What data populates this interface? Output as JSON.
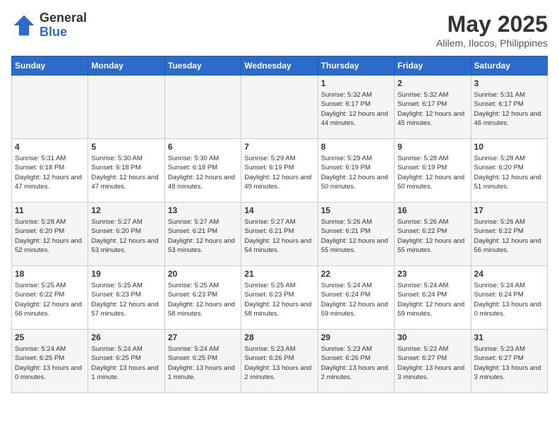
{
  "logo": {
    "general": "General",
    "blue": "Blue"
  },
  "title": "May 2025",
  "location": "Alilem, Ilocos, Philippines",
  "days_of_week": [
    "Sunday",
    "Monday",
    "Tuesday",
    "Wednesday",
    "Thursday",
    "Friday",
    "Saturday"
  ],
  "weeks": [
    [
      {
        "day": "",
        "info": ""
      },
      {
        "day": "",
        "info": ""
      },
      {
        "day": "",
        "info": ""
      },
      {
        "day": "",
        "info": ""
      },
      {
        "day": "1",
        "info": "Sunrise: 5:32 AM\nSunset: 6:17 PM\nDaylight: 12 hours\nand 44 minutes."
      },
      {
        "day": "2",
        "info": "Sunrise: 5:32 AM\nSunset: 6:17 PM\nDaylight: 12 hours\nand 45 minutes."
      },
      {
        "day": "3",
        "info": "Sunrise: 5:31 AM\nSunset: 6:17 PM\nDaylight: 12 hours\nand 46 minutes."
      }
    ],
    [
      {
        "day": "4",
        "info": "Sunrise: 5:31 AM\nSunset: 6:18 PM\nDaylight: 12 hours\nand 47 minutes."
      },
      {
        "day": "5",
        "info": "Sunrise: 5:30 AM\nSunset: 6:18 PM\nDaylight: 12 hours\nand 47 minutes."
      },
      {
        "day": "6",
        "info": "Sunrise: 5:30 AM\nSunset: 6:18 PM\nDaylight: 12 hours\nand 48 minutes."
      },
      {
        "day": "7",
        "info": "Sunrise: 5:29 AM\nSunset: 6:19 PM\nDaylight: 12 hours\nand 49 minutes."
      },
      {
        "day": "8",
        "info": "Sunrise: 5:29 AM\nSunset: 6:19 PM\nDaylight: 12 hours\nand 50 minutes."
      },
      {
        "day": "9",
        "info": "Sunrise: 5:28 AM\nSunset: 6:19 PM\nDaylight: 12 hours\nand 50 minutes."
      },
      {
        "day": "10",
        "info": "Sunrise: 5:28 AM\nSunset: 6:20 PM\nDaylight: 12 hours\nand 51 minutes."
      }
    ],
    [
      {
        "day": "11",
        "info": "Sunrise: 5:28 AM\nSunset: 6:20 PM\nDaylight: 12 hours\nand 52 minutes."
      },
      {
        "day": "12",
        "info": "Sunrise: 5:27 AM\nSunset: 6:20 PM\nDaylight: 12 hours\nand 53 minutes."
      },
      {
        "day": "13",
        "info": "Sunrise: 5:27 AM\nSunset: 6:21 PM\nDaylight: 12 hours\nand 53 minutes."
      },
      {
        "day": "14",
        "info": "Sunrise: 5:27 AM\nSunset: 6:21 PM\nDaylight: 12 hours\nand 54 minutes."
      },
      {
        "day": "15",
        "info": "Sunrise: 5:26 AM\nSunset: 6:21 PM\nDaylight: 12 hours\nand 55 minutes."
      },
      {
        "day": "16",
        "info": "Sunrise: 5:26 AM\nSunset: 6:22 PM\nDaylight: 12 hours\nand 55 minutes."
      },
      {
        "day": "17",
        "info": "Sunrise: 5:26 AM\nSunset: 6:22 PM\nDaylight: 12 hours\nand 56 minutes."
      }
    ],
    [
      {
        "day": "18",
        "info": "Sunrise: 5:25 AM\nSunset: 6:22 PM\nDaylight: 12 hours\nand 56 minutes."
      },
      {
        "day": "19",
        "info": "Sunrise: 5:25 AM\nSunset: 6:23 PM\nDaylight: 12 hours\nand 57 minutes."
      },
      {
        "day": "20",
        "info": "Sunrise: 5:25 AM\nSunset: 6:23 PM\nDaylight: 12 hours\nand 58 minutes."
      },
      {
        "day": "21",
        "info": "Sunrise: 5:25 AM\nSunset: 6:23 PM\nDaylight: 12 hours\nand 58 minutes."
      },
      {
        "day": "22",
        "info": "Sunrise: 5:24 AM\nSunset: 6:24 PM\nDaylight: 12 hours\nand 59 minutes."
      },
      {
        "day": "23",
        "info": "Sunrise: 5:24 AM\nSunset: 6:24 PM\nDaylight: 12 hours\nand 59 minutes."
      },
      {
        "day": "24",
        "info": "Sunrise: 5:24 AM\nSunset: 6:24 PM\nDaylight: 13 hours\nand 0 minutes."
      }
    ],
    [
      {
        "day": "25",
        "info": "Sunrise: 5:24 AM\nSunset: 6:25 PM\nDaylight: 13 hours\nand 0 minutes."
      },
      {
        "day": "26",
        "info": "Sunrise: 5:24 AM\nSunset: 6:25 PM\nDaylight: 13 hours\nand 1 minute."
      },
      {
        "day": "27",
        "info": "Sunrise: 5:24 AM\nSunset: 6:25 PM\nDaylight: 13 hours\nand 1 minute."
      },
      {
        "day": "28",
        "info": "Sunrise: 5:23 AM\nSunset: 6:26 PM\nDaylight: 13 hours\nand 2 minutes."
      },
      {
        "day": "29",
        "info": "Sunrise: 5:23 AM\nSunset: 6:26 PM\nDaylight: 13 hours\nand 2 minutes."
      },
      {
        "day": "30",
        "info": "Sunrise: 5:23 AM\nSunset: 6:27 PM\nDaylight: 13 hours\nand 3 minutes."
      },
      {
        "day": "31",
        "info": "Sunrise: 5:23 AM\nSunset: 6:27 PM\nDaylight: 13 hours\nand 3 minutes."
      }
    ]
  ]
}
